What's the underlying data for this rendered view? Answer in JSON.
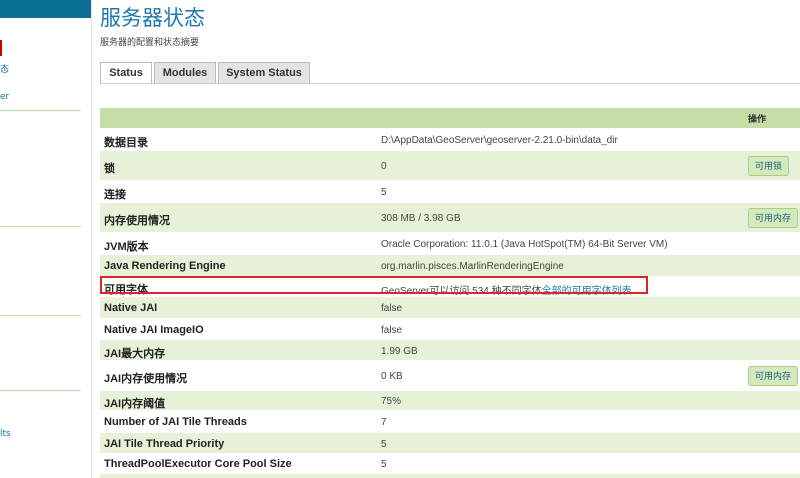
{
  "sidebar": {
    "fragment_1": "态",
    "fragment_2": "er",
    "fragment_3": "lts"
  },
  "page": {
    "title": "服务器状态",
    "subtitle": "服务器的配置和状态摘要"
  },
  "tabs": [
    {
      "label": "Status",
      "active": true
    },
    {
      "label": "Modules",
      "active": false
    },
    {
      "label": "System Status",
      "active": false
    }
  ],
  "table": {
    "actions_header": "操作",
    "rows": [
      {
        "label": "数据目录",
        "value": "D:\\AppData\\GeoServer\\geoserver-2.21.0-bin\\data_dir",
        "action": ""
      },
      {
        "label": "锁",
        "value": "0",
        "action": "可用锁"
      },
      {
        "label": "连接",
        "value": "5",
        "action": ""
      },
      {
        "label": "内存使用情况",
        "value": "308 MB / 3.98 GB",
        "action": "可用内存"
      },
      {
        "label": "JVM版本",
        "value": "Oracle Corporation: 11.0.1 (Java HotSpot(TM) 64-Bit Server VM)",
        "action": ""
      },
      {
        "label": "Java Rendering Engine",
        "value": "org.marlin.pisces.MarlinRenderingEngine",
        "action": ""
      },
      {
        "label": "可用字体",
        "value": "GeoServer可以访问 534 种不同字体",
        "link": "全部的可用字体列表",
        "action": ""
      },
      {
        "label": "Native JAI",
        "value": "false",
        "action": ""
      },
      {
        "label": "Native JAI ImageIO",
        "value": "false",
        "action": ""
      },
      {
        "label": "JAI最大内存",
        "value": "1.99 GB",
        "action": ""
      },
      {
        "label": "JAI内存使用情况",
        "value": "0 KB",
        "action": "可用内存"
      },
      {
        "label": "JAI内存阈值",
        "value": "75%",
        "action": ""
      },
      {
        "label": "Number of JAI Tile Threads",
        "value": "7",
        "action": ""
      },
      {
        "label": "JAI Tile Thread Priority",
        "value": "5",
        "action": ""
      },
      {
        "label": "ThreadPoolExecutor Core Pool Size",
        "value": "5",
        "action": ""
      }
    ]
  },
  "colors": {
    "title": "#1d79ad",
    "header_band": "#c5dea5",
    "row_alt": "#e6f1d8",
    "highlight": "#d9262b"
  }
}
